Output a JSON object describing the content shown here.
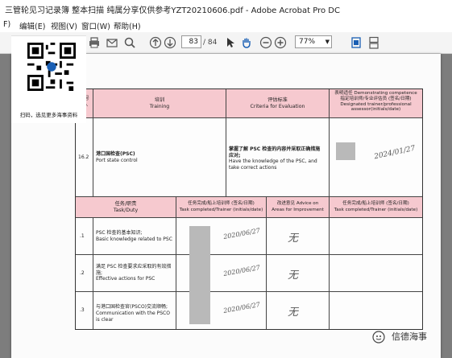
{
  "window": {
    "title": "三管轮见习记录簿  整本扫描  纯属分享仅供参考YZT20210606.pdf - Adobe Acrobat Pro DC"
  },
  "menubar": {
    "items": [
      "F)",
      "编辑(E)",
      "视图(V)",
      "窗口(W)",
      "帮助(H)"
    ]
  },
  "toolbar": {
    "page_current": "83",
    "page_total": "/ 84",
    "zoom": "77%",
    "icons": [
      "print-icon",
      "email-icon",
      "search-icon",
      "prev-page-icon",
      "next-page-icon",
      "cursor-icon",
      "hand-icon",
      "zoom-out-icon",
      "zoom-in-icon",
      "fit-page-icon",
      "scroll-mode-icon"
    ]
  },
  "qr_panel": {
    "caption": "扫码，选见更多海事资料"
  },
  "form": {
    "header": {
      "no_label": "编号\nNo.",
      "training_cn": "培训",
      "training_en": "Training",
      "criteria_cn": "评估标准",
      "criteria_en": "Criteria for Evaluation",
      "designated": "表明适任 Demonstrating competence\n指定培训师/专业评估员 (签名/日期)\nDesignated trainer/professional\nassessor(initials/date)"
    },
    "item": {
      "no": "16.2",
      "training_cn": "港口国检查(PSC)",
      "training_en": "Port state control",
      "criteria_cn": "掌握了解 PSC 检查的内容并采取正确措施应对;",
      "criteria_en": "Have the knowledge of the PSC, and take correct actions",
      "signature": "2024/01/27"
    },
    "task_header": {
      "task_cn": "任务/职责",
      "task_en": "Task/Duty",
      "completed_cn": "任务完成/船上培训师 (签名/日期)",
      "completed_en": "Task completed/Trainer (initials/date)",
      "advice_cn": "改进意见 Advice on",
      "advice_en": "Areas for Improvement",
      "completed2_cn": "任务完成/船上培训师 (签名/日期)",
      "completed2_en": "Task completed/Trainer (initials/date)"
    },
    "tasks": [
      {
        "no": ".1",
        "cn": "PSC 检查的基本知识;",
        "en": "Basic knowledge related to PSC",
        "date": "2020/06/27",
        "advice": "无"
      },
      {
        "no": ".2",
        "cn": "满足 PSC 检查要求应采取的有效措施;",
        "en": "Effective actions for PSC",
        "date": "2020/06/27",
        "advice": "无"
      },
      {
        "no": ".3",
        "cn": "与港口国检查官(PSCO)交流顺畅;",
        "en": "Communication with the PSCO is clear",
        "date": "2020/06/27",
        "advice": "无"
      }
    ]
  },
  "watermark": {
    "text": "信德海事"
  },
  "colors": {
    "header_pink": "#f6c9cf",
    "titlebar_bg": "#ffffff",
    "doc_gray": "#7d7d7d"
  }
}
